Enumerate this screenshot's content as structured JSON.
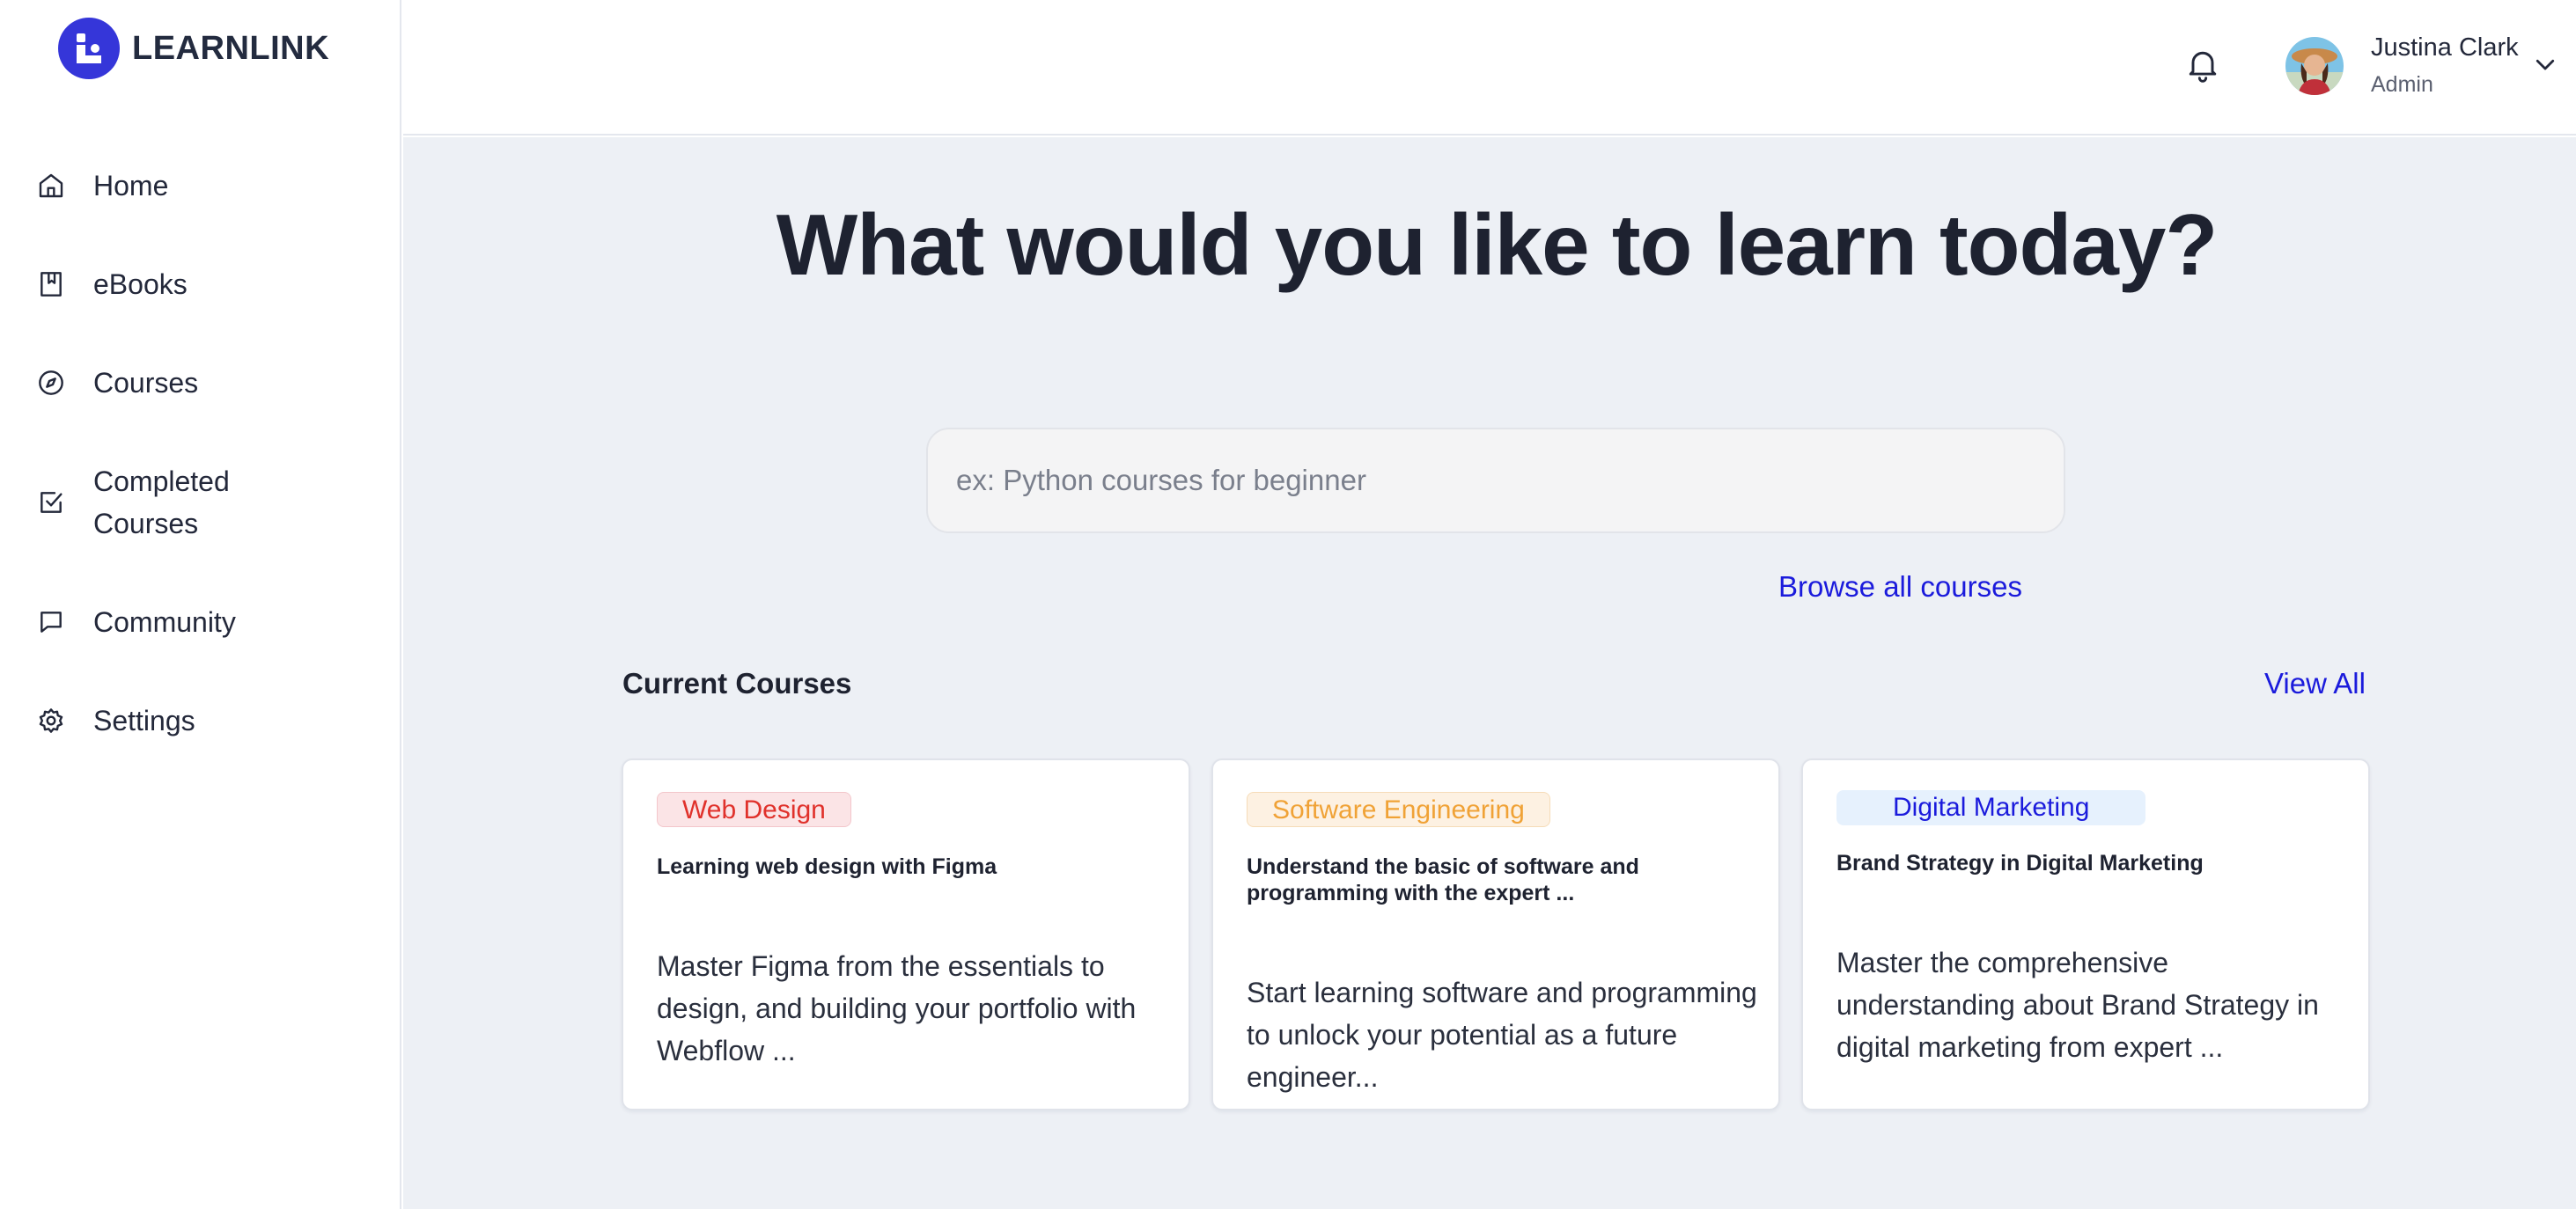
{
  "brand": {
    "name": "LEARNLINK",
    "accent": "#3536d9"
  },
  "sidebar": {
    "items": [
      {
        "label": "Home",
        "icon": "home-icon"
      },
      {
        "label": "eBooks",
        "icon": "book-icon"
      },
      {
        "label": "Courses",
        "icon": "compass-icon"
      },
      {
        "label": "Completed Courses",
        "icon": "check-square-icon"
      },
      {
        "label": "Community",
        "icon": "message-square-icon"
      },
      {
        "label": "Settings",
        "icon": "gear-icon"
      }
    ]
  },
  "header": {
    "user": {
      "name": "Justina Clark",
      "role": "Admin"
    }
  },
  "main": {
    "title": "What would you like to learn today?",
    "search": {
      "placeholder": "ex: Python courses for beginner",
      "value": ""
    },
    "browse_label": "Browse all courses",
    "current_courses": {
      "title": "Current Courses",
      "view_all_label": "View All",
      "cards": [
        {
          "tag": "Web Design",
          "tag_color": "#e0312b",
          "tag_bg": "#fbe4e6",
          "title": "Learning web design with Figma",
          "description": "Master Figma from the essentials to design, and building your portfolio with Webflow ..."
        },
        {
          "tag": "Software Engineering",
          "tag_color": "#f0a236",
          "tag_bg": "#fdf1e2",
          "title": "Understand the basic of software and programming with the expert ...",
          "description": "Start learning software and programming to unlock your potential as a future engineer..."
        },
        {
          "tag": "Digital Marketing",
          "tag_color": "#1b1bdc",
          "tag_bg": "#e6f1fd",
          "title": "Brand Strategy in Digital Marketing",
          "description": "Master the comprehensive understanding about Brand Strategy in digital marketing from expert ..."
        }
      ]
    }
  }
}
